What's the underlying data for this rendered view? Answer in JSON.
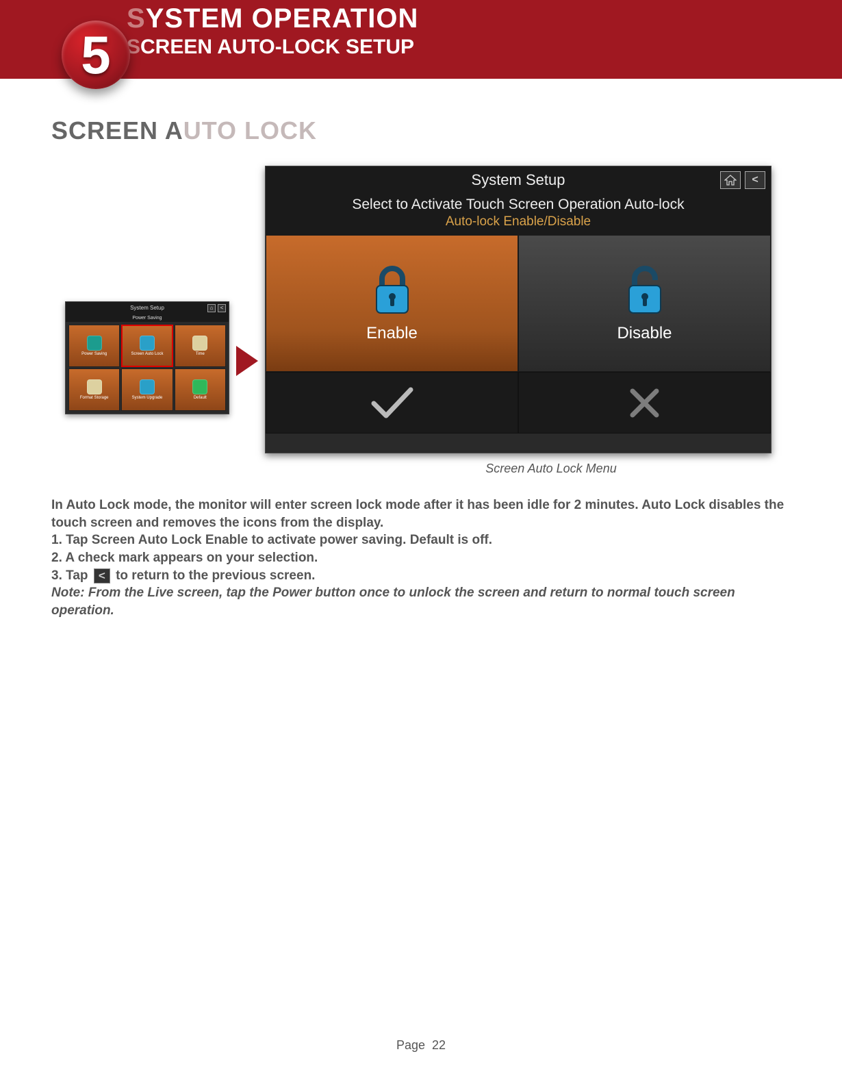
{
  "header": {
    "chapter_number": "5",
    "title_prefix": "S",
    "title_rest": "YSTEM OPERATION",
    "subtitle_prefix": "S",
    "subtitle_rest": "CREEN AUTO-LOCK SETUP"
  },
  "page_title_prefix": "SCREEN A",
  "page_title_rest": "UTO LOCK",
  "small_screen": {
    "title": "System Setup",
    "subtitle": "Power Saving",
    "cells": [
      {
        "label": "Power Saving"
      },
      {
        "label": "Screen Auto Lock"
      },
      {
        "label": "Time"
      },
      {
        "label": "Format Storage"
      },
      {
        "label": "System Upgrade"
      },
      {
        "label": "Default"
      }
    ]
  },
  "big_screen": {
    "title": "System Setup",
    "sub1": "Select to Activate Touch Screen Operation Auto-lock",
    "sub2": "Auto-lock Enable/Disable",
    "enable": "Enable",
    "disable": "Disable"
  },
  "caption": "Screen Auto Lock Menu",
  "body": {
    "intro": "In Auto Lock mode, the monitor will enter screen lock mode after it has been idle for 2 minutes. Auto Lock disables the touch screen and removes the icons from the display.",
    "step1": "1. Tap Screen Auto Lock Enable to activate power saving. Default is off.",
    "step2": "2. A check mark appears on your selection.",
    "step3_a": "3. Tap",
    "step3_b": "to return to the previous screen.",
    "note": "Note: From the Live screen, tap the Power button once to unlock the screen and return to normal touch screen operation."
  },
  "footer": {
    "page_label": "Page",
    "page_number": "22"
  }
}
